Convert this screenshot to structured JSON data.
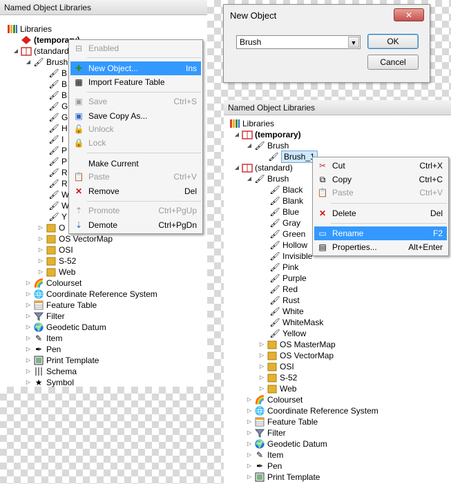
{
  "left": {
    "title": "Named Object Libraries",
    "tree": [
      {
        "label": "Libraries",
        "icon": "libraries-icon",
        "bold": false
      },
      {
        "label": "(temporary)",
        "icon": "library-red-icon",
        "bold": true
      },
      {
        "label": "(standard)",
        "icon": "library-icon",
        "bold": false
      },
      {
        "label": "Brush",
        "icon": "brush-icon",
        "bold": false
      },
      {
        "label": "OS VectorMap",
        "icon": "folder-icon"
      },
      {
        "label": "OSI",
        "icon": "folder-icon"
      },
      {
        "label": "S-52",
        "icon": "folder-icon"
      },
      {
        "label": "Web",
        "icon": "folder-icon"
      },
      {
        "label": "Colourset",
        "icon": "colourset-icon"
      },
      {
        "label": "Coordinate Reference System",
        "icon": "globe-icon"
      },
      {
        "label": "Feature Table",
        "icon": "table-icon"
      },
      {
        "label": "Filter",
        "icon": "filter-icon"
      },
      {
        "label": "Geodetic Datum",
        "icon": "datum-icon"
      },
      {
        "label": "Item",
        "icon": "item-icon"
      },
      {
        "label": "Pen",
        "icon": "pen-icon"
      },
      {
        "label": "Print Template",
        "icon": "print-template-icon"
      },
      {
        "label": "Schema",
        "icon": "schema-icon"
      },
      {
        "label": "Symbol",
        "icon": "symbol-icon"
      }
    ],
    "brush_partial": [
      "B",
      "B",
      "B",
      "G",
      "G",
      "H",
      "I",
      "P",
      "P",
      "R",
      "R",
      "W",
      "W",
      "Y",
      "O"
    ],
    "menu": [
      {
        "label": "Enabled",
        "key": "",
        "disabled": true
      },
      {
        "label": "New Object...",
        "key": "Ins",
        "disabled": false,
        "highlight": true
      },
      {
        "label": "Import Feature Table",
        "key": "",
        "disabled": false
      },
      {
        "label": "Save",
        "key": "Ctrl+S",
        "disabled": true
      },
      {
        "label": "Save Copy As...",
        "key": "",
        "disabled": false
      },
      {
        "label": "Unlock",
        "key": "",
        "disabled": true
      },
      {
        "label": "Lock",
        "key": "",
        "disabled": true
      },
      {
        "label": "Make Current",
        "key": "",
        "disabled": false
      },
      {
        "label": "Paste",
        "key": "Ctrl+V",
        "disabled": true
      },
      {
        "label": "Remove",
        "key": "Del",
        "disabled": false
      },
      {
        "label": "Promote",
        "key": "Ctrl+PgUp",
        "disabled": true
      },
      {
        "label": "Demote",
        "key": "Ctrl+PgDn",
        "disabled": false
      }
    ]
  },
  "dialog": {
    "title": "New Object",
    "select_value": "Brush",
    "ok_label": "OK",
    "cancel_label": "Cancel",
    "close_label": "✕"
  },
  "right": {
    "title": "Named Object Libraries",
    "tree": [
      {
        "label": "Libraries"
      },
      {
        "label": "(temporary)"
      },
      {
        "label": "Brush"
      },
      {
        "label": "Brush_1"
      },
      {
        "label": "(standard)"
      },
      {
        "label": "Brush"
      },
      {
        "label": "Black"
      },
      {
        "label": "Blank"
      },
      {
        "label": "Blue"
      },
      {
        "label": "Gray"
      },
      {
        "label": "Green"
      },
      {
        "label": "Hollow"
      },
      {
        "label": "Invisible"
      },
      {
        "label": "Pink"
      },
      {
        "label": "Purple"
      },
      {
        "label": "Red"
      },
      {
        "label": "Rust"
      },
      {
        "label": "White"
      },
      {
        "label": "WhiteMask"
      },
      {
        "label": "Yellow"
      },
      {
        "label": "OS MasterMap"
      },
      {
        "label": "OS VectorMap"
      },
      {
        "label": "OSI"
      },
      {
        "label": "S-52"
      },
      {
        "label": "Web"
      },
      {
        "label": "Colourset"
      },
      {
        "label": "Coordinate Reference System"
      },
      {
        "label": "Feature Table"
      },
      {
        "label": "Filter"
      },
      {
        "label": "Geodetic Datum"
      },
      {
        "label": "Item"
      },
      {
        "label": "Pen"
      },
      {
        "label": "Print Template"
      }
    ],
    "menu": [
      {
        "label": "Cut",
        "key": "Ctrl+X",
        "disabled": false
      },
      {
        "label": "Copy",
        "key": "Ctrl+C",
        "disabled": false
      },
      {
        "label": "Paste",
        "key": "Ctrl+V",
        "disabled": true
      },
      {
        "label": "Delete",
        "key": "Del",
        "disabled": false
      },
      {
        "label": "Rename",
        "key": "F2",
        "disabled": false,
        "highlight": true
      },
      {
        "label": "Properties...",
        "key": "Alt+Enter",
        "disabled": false
      }
    ]
  },
  "colors": {
    "highlight": "#3399ff",
    "disabled": "#9b9b9b",
    "delete_red": "#d01010"
  }
}
